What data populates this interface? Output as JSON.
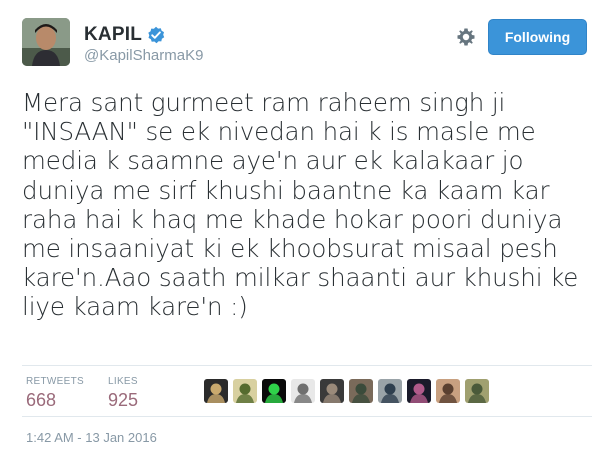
{
  "user": {
    "display_name": "KAPIL",
    "handle": "@KapilSharmaK9",
    "verified": true
  },
  "actions": {
    "follow_label": "Following"
  },
  "tweet": {
    "lines": [
      "Mera sant gurmeet ram raheem singh ji",
      "\"INSAAN\" se ek nivedan hai k is masle me",
      "media k saamne aye'n aur ek kalakaar jo",
      "duniya me sirf khushi baantne ka kaam kar",
      "raha hai k haq me khade hokar poori duniya",
      "me insaaniyat ki ek khoobsurat misaal pesh",
      "kare'n.Aao saath milkar shaanti aur khushi ke",
      "liye kaam kare'n :)"
    ],
    "timestamp": "1:42 AM - 13 Jan 2016"
  },
  "stats": {
    "retweets_label": "RETWEETS",
    "retweets_value": "668",
    "likes_label": "LIKES",
    "likes_value": "925"
  },
  "likers": [
    {
      "name": "liker-avatar-1",
      "colors": [
        "#2b2b2b",
        "#c9a96e"
      ]
    },
    {
      "name": "liker-avatar-2",
      "colors": [
        "#d8d0a0",
        "#556b2f"
      ]
    },
    {
      "name": "liker-avatar-3",
      "colors": [
        "#0a0a0a",
        "#2fd24a"
      ]
    },
    {
      "name": "liker-avatar-4",
      "colors": [
        "#e8e8e8",
        "#6f6f6f"
      ]
    },
    {
      "name": "liker-avatar-5",
      "colors": [
        "#3a3a3a",
        "#9a8a7a"
      ]
    },
    {
      "name": "liker-avatar-6",
      "colors": [
        "#7a6a5a",
        "#3b4b3b"
      ]
    },
    {
      "name": "liker-avatar-7",
      "colors": [
        "#9aa3a8",
        "#2f3f4f"
      ]
    },
    {
      "name": "liker-avatar-8",
      "colors": [
        "#1a1a2a",
        "#b05a8a"
      ]
    },
    {
      "name": "liker-avatar-9",
      "colors": [
        "#c8a080",
        "#5a4030"
      ]
    },
    {
      "name": "liker-avatar-10",
      "colors": [
        "#a0a070",
        "#4a5a3a"
      ]
    }
  ],
  "theme": {
    "follow_bg": "#3b94d9",
    "verified": "#3b94d9",
    "stat_value": "#9a6a7a",
    "muted": "#8899a6"
  }
}
